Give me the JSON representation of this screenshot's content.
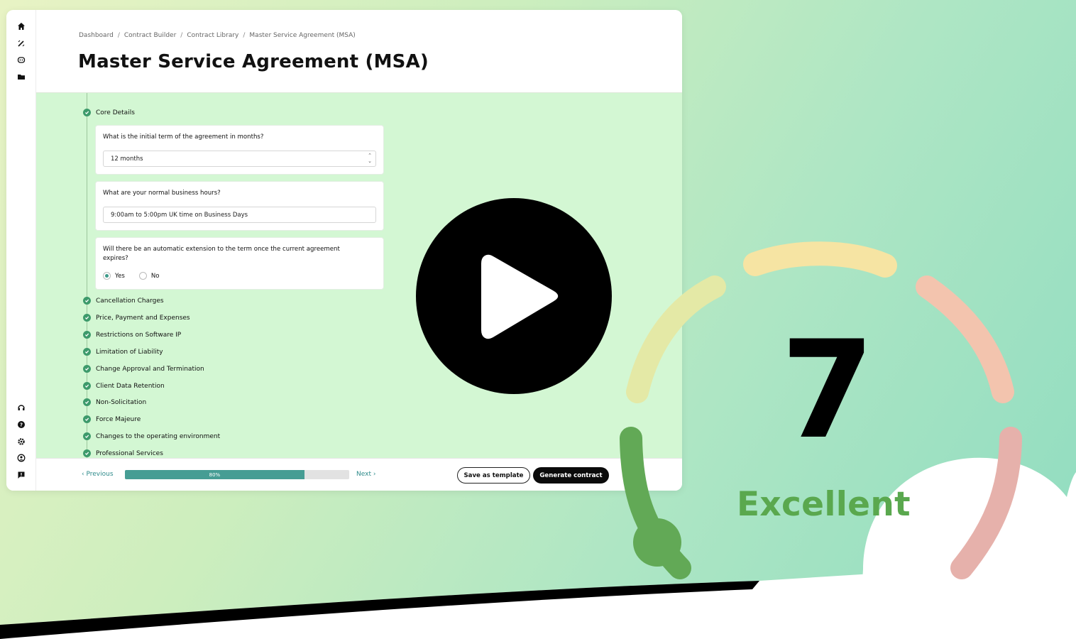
{
  "breadcrumbs": [
    "Dashboard",
    "Contract Builder",
    "Contract Library",
    "Master Service Agreement (MSA)"
  ],
  "page_title": "Master Service Agreement (MSA)",
  "sidebar": {
    "top_icons": [
      "home-icon",
      "magic-wand-icon",
      "robot-icon",
      "folder-icon"
    ],
    "bottom_icons": [
      "headset-icon",
      "help-icon",
      "settings-icon",
      "user-icon",
      "feedback-icon"
    ]
  },
  "sections": {
    "core": "Core Details",
    "items": [
      "Cancellation Charges",
      "Price, Payment and Expenses",
      "Restrictions on Software IP",
      "Limitation of Liability",
      "Change Approval and Termination",
      "Client Data Retention",
      "Non-Solicitation",
      "Force Majeure",
      "Changes to the operating environment",
      "Professional Services"
    ]
  },
  "questions": {
    "term": {
      "label": "What is the initial term of the agreement in months?",
      "value": "12 months"
    },
    "hours": {
      "label": "What are your normal business hours?",
      "value": "9:00am to 5:00pm UK time on Business Days"
    },
    "extension": {
      "label": "Will there be an automatic extension to the term once the current agreement expires?",
      "options": [
        "Yes",
        "No"
      ],
      "selected": "Yes"
    }
  },
  "footer": {
    "previous": "Previous",
    "next": "Next",
    "progress_label": "80%",
    "progress_value": 0.8,
    "save_template": "Save as template",
    "generate": "Generate contract"
  },
  "score": {
    "value": "7",
    "label": "Excellent"
  },
  "colors": {
    "accent": "#469d94",
    "check": "#3d9a6b",
    "score_label": "#5aa84e",
    "gauge_segments": [
      "#62a956",
      "#e4e9a6",
      "#f6e4a3",
      "#f3c4ae",
      "#e6b1ab"
    ]
  }
}
